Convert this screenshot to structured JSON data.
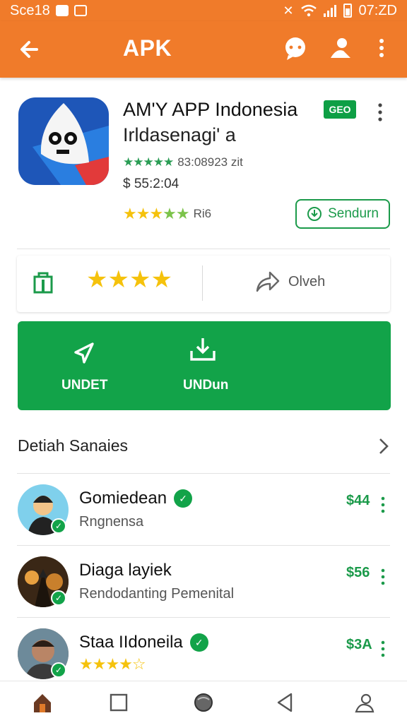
{
  "status_bar": {
    "left_text": "Sce18",
    "time": "07:ZD"
  },
  "app_bar": {
    "title": "APK"
  },
  "app": {
    "name": "AM'Y APP Indonesia",
    "badge": "GEO",
    "subtitle": "Irldasenagi' a",
    "rating_stars": "★★★★★",
    "rating_count": "83:08923 zit",
    "price": "$ 55:2:04",
    "stars_row": "★★★★★",
    "stars_row_label": "Ri6",
    "send_button_label": "Sendurn"
  },
  "actions": {
    "stars": "★★★★",
    "share_label": "Olveh"
  },
  "panel": {
    "left_label": "UNDET",
    "right_label": "UNDun"
  },
  "section": {
    "title": "Detiah Sanaies"
  },
  "list": [
    {
      "title": "Gomiedean",
      "subtitle": "Rngnensa",
      "price": "$44",
      "avatar_bg": "#7fd0ec"
    },
    {
      "title": "Diaga layiek",
      "subtitle": "Rendodanting Pemenital",
      "price": "$56",
      "avatar_bg": "#6b4a2a"
    },
    {
      "title": "Staa IIdoneila",
      "stars": "★★★★☆",
      "price": "$3A",
      "avatar_bg": "#a07a60"
    }
  ],
  "colors": {
    "accent_orange": "#f07b2a",
    "green": "#12a349",
    "star_yellow": "#f5c20c"
  }
}
